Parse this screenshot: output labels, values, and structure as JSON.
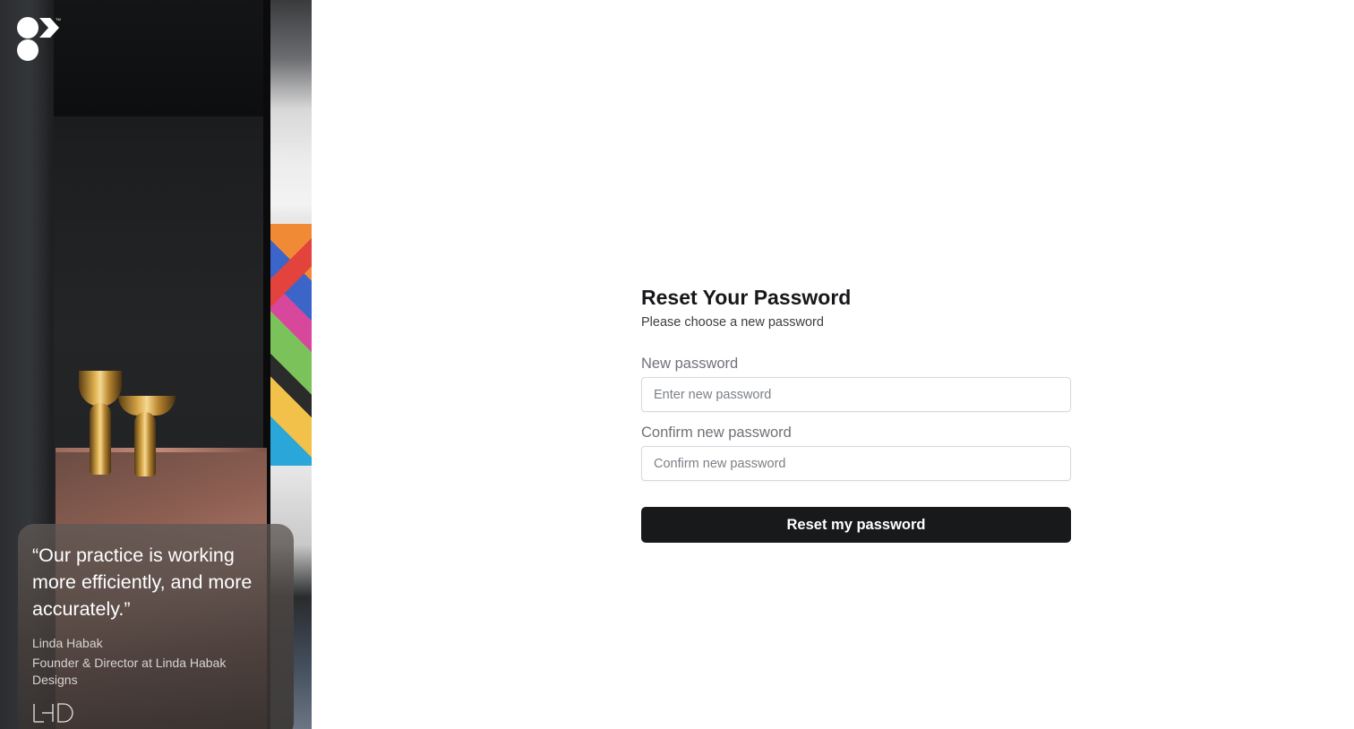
{
  "brand": {
    "logo_icon": "company-logo-icon"
  },
  "testimonial": {
    "quote": "“Our practice is working more efficiently, and more accurately.”",
    "author": "Linda Habak",
    "role": "Founder & Director at Linda Habak Designs",
    "client_logo_icon": "lhd-logo-icon"
  },
  "form": {
    "title": "Reset Your Password",
    "subtitle": "Please choose a new password",
    "new_password": {
      "label": "New password",
      "placeholder": "Enter new password",
      "value": ""
    },
    "confirm_password": {
      "label": "Confirm new password",
      "placeholder": "Confirm new password",
      "value": ""
    },
    "submit_label": "Reset my password"
  },
  "colors": {
    "button_bg": "#18191b",
    "button_text": "#ffffff",
    "title_text": "#17181a",
    "label_text": "#6f7278",
    "input_border": "#d6d8db"
  }
}
